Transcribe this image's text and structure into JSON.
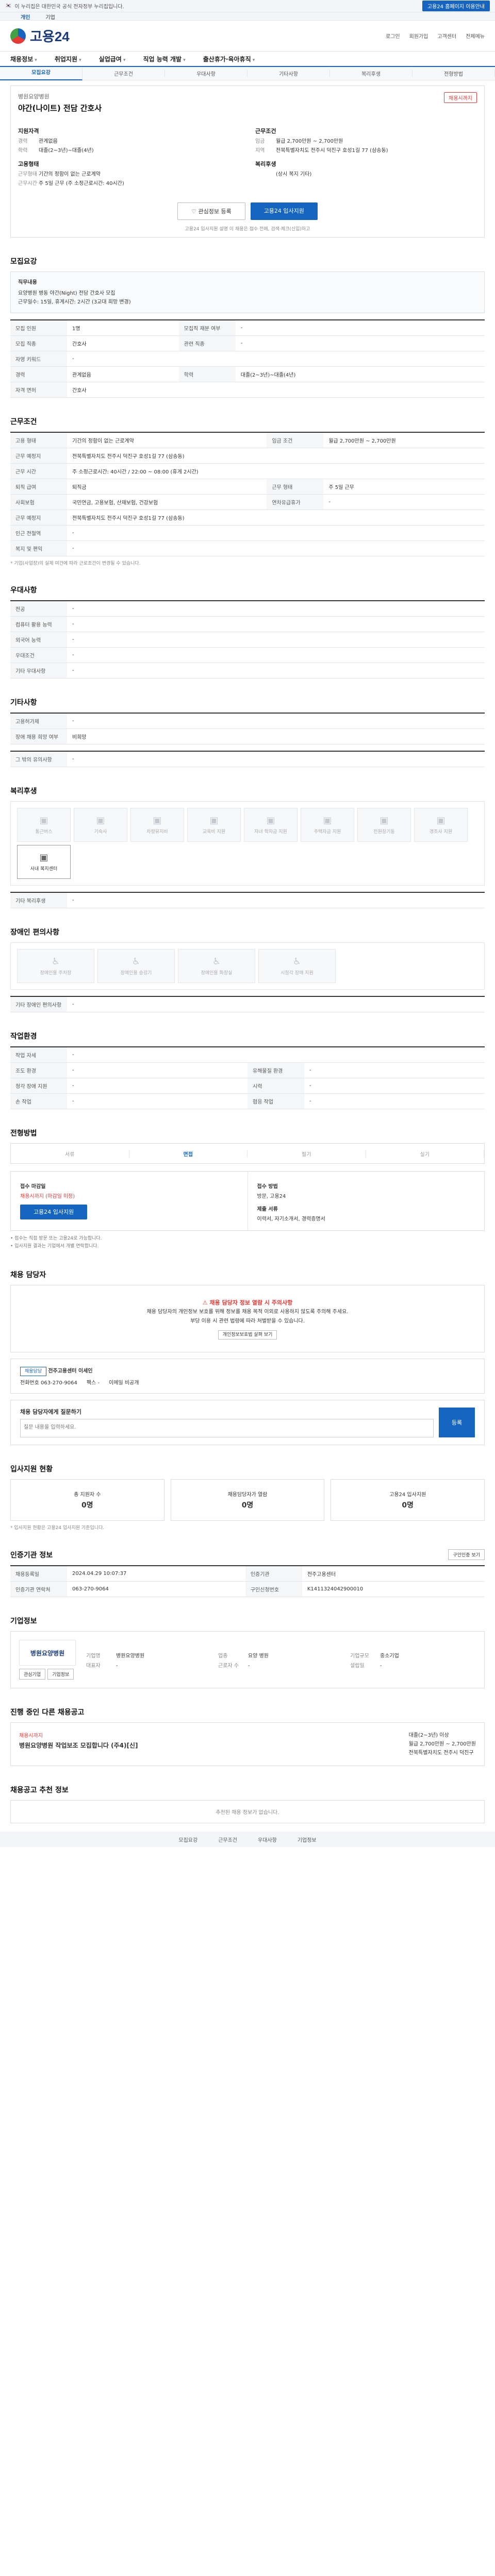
{
  "topbar": {
    "notice": "이 누리집은 대한민국 공식 전자정부 누리집입니다.",
    "tab_person": "개인",
    "tab_company": "기업",
    "right_btn": "고용24 홈페이지 이용안내"
  },
  "logo": {
    "name": "고용24"
  },
  "header_links": [
    "로그인",
    "회원가입",
    "고객센터",
    "전체메뉴"
  ],
  "nav": [
    "채용정보",
    "취업지원",
    "실업급여",
    "직업 능력 개발",
    "출산휴가·육아휴직"
  ],
  "subnav": [
    "모집요강",
    "근무조건",
    "우대사항",
    "기타사항",
    "복리후생",
    "전형방법"
  ],
  "summary": {
    "company": "병원요양병원",
    "title": "야간(나이트) 전담 간호사",
    "badge": "채용시까지",
    "left_title": "지원자격",
    "right_title": "근무조건",
    "left": [
      {
        "k": "경력",
        "v": "관계없음"
      },
      {
        "k": "학력",
        "v": "대졸(2~3년)~대졸(4년)"
      }
    ],
    "right": [
      {
        "k": "임금",
        "v": "월급 2,700만원 ~ 2,700만원"
      },
      {
        "k": "지역",
        "v": "전북특별자치도 전주시 덕진구 호성1길 77 (삼송동)"
      }
    ],
    "left2_title": "고용형태",
    "left2": [
      {
        "k": "근무형태",
        "v": "기간의 정함이 없는 근로계약"
      },
      {
        "k": "근무시간",
        "v": "주 5일 근무 (주 소정근로시간: 40시간)"
      }
    ],
    "right2_title": "복리후생",
    "right2": [
      {
        "k": "",
        "v": "(상시 복지 기타)"
      }
    ],
    "save_btn": "관심정보 등록",
    "apply_btn": "고용24 입사지원",
    "note": "고용24 입사지원 설명 이 채용은 접수 전에, 검색·체크(신입)하고 "
  },
  "recruit": {
    "section": "모집요강",
    "box_h": "직무내용",
    "box_lines": [
      "요양병원 병동 야간(Night) 전담 간호사 모집",
      "근무일수: 15일, 휴게시간: 2시간 (3교대 희망 변경)"
    ],
    "rows": [
      [
        "모집 인원",
        "1명",
        "모집직 재분 여부",
        "-"
      ],
      [
        "모집 직종",
        "간호사",
        "관련 직종",
        "-"
      ],
      [
        "자영 키워드",
        "-",
        "",
        ""
      ],
      [
        "경력",
        "관계없음",
        "학력",
        "대졸(2~3년)~대졸(4년)"
      ],
      [
        "자격 면허",
        "간호사",
        "",
        ""
      ]
    ]
  },
  "condition": {
    "section": "근무조건",
    "rows": [
      [
        "고용 형태",
        "기간의 정함이 없는 근로계약",
        "임금 조건",
        "월급 2,700만원 ~ 2,700만원"
      ],
      [
        "근무 예정지",
        "전북특별자치도 전주시 덕진구 호성1길 77 (삼송동)",
        "",
        ""
      ],
      [
        "근무 시간",
        "주 소정근로시간: 40시간 / 22:00 ~ 08:00 (휴게 2시간)",
        "",
        ""
      ],
      [
        "퇴직 급여",
        "퇴직금",
        "근무 형태",
        "주 5일 근무"
      ],
      [
        "사회보험",
        "국민연금, 고용보험, 산재보험, 건강보험",
        "연차유급휴가",
        "-"
      ],
      [
        "근무 예정지",
        "전북특별자치도 전주시 덕진구 호성1길 77 (삼송동)",
        "",
        ""
      ],
      [
        "인근 전철역",
        "-",
        "",
        ""
      ],
      [
        "복지 및 편익",
        "-",
        "",
        ""
      ]
    ],
    "note": "* 기업(사업장)의 실제 여건에 따라 근로조건이 변경될 수 있습니다."
  },
  "prefer": {
    "section": "우대사항",
    "rows": [
      [
        "전공",
        "-"
      ],
      [
        "컴퓨터 활용 능력",
        "-"
      ],
      [
        "외국어 능력",
        "-"
      ],
      [
        "우대조건",
        "-"
      ],
      [
        "기타 우대사항",
        "-"
      ]
    ]
  },
  "etc": {
    "section": "기타사항",
    "rows": [
      [
        "고용허가제",
        "-"
      ],
      [
        "장애 채용 희망 여부",
        "비희망"
      ]
    ],
    "sub_h": "그 밖의 유의사항",
    "sub_v": "-"
  },
  "welfare": {
    "section": "복리후생",
    "items": [
      "통근버스",
      "기숙사",
      "차량유지비",
      "교육비 지원",
      "자녀 학자금 지원",
      "주택자금 지원",
      "전원장기동",
      "경조사 지원",
      "사내 복지센터"
    ],
    "active_index": 8,
    "extra_h": "기타 복리후생",
    "extra_v": "-"
  },
  "disability": {
    "section": "장애인 편의사항",
    "items": [
      "장애인용 주차장",
      "장애인용 승강기",
      "장애인용 화장실",
      "시청각 장애 지원"
    ],
    "extra_h": "기타 장애인 편의사항",
    "extra_v": "-"
  },
  "workenv": {
    "section": "작업환경",
    "rows": [
      [
        "작업 자세",
        "-",
        "",
        ""
      ],
      [
        "조도 환경",
        "-",
        "유해물질 환경",
        "-"
      ],
      [
        "청각 장애 지원",
        "-",
        "시력",
        "-"
      ],
      [
        "손 작업",
        "-",
        "협응 작업",
        "-"
      ]
    ]
  },
  "selection": {
    "section": "전형방법",
    "steps": [
      "서류",
      "면접",
      "필기",
      "실기"
    ],
    "active": 1,
    "apply_left_h": "접수 마감일",
    "apply_left_v": "채용시까지 (마감일 미정)",
    "apply_left_btn": "고용24 입사지원",
    "apply_right_h": "접수 방법",
    "apply_right_v": "방문, 고용24",
    "apply_right_h2": "제출 서류",
    "apply_right_v2": "이력서, 자기소개서, 경력증명서",
    "notes": [
      "• 접수는 직접 방문 또는 고용24로 가능합니다.",
      "• 입사지원 결과는 기업에서 개별 연락합니다."
    ]
  },
  "manager": {
    "section": "채용 담당자",
    "warn_title": "채용 담당자 정보 열람 시 주의사항",
    "warn_lines": [
      "채용 담당자의 개인정보 보호를 위해 정보를 채용 목적 이외로 사용하지 않도록 주의해 주세요.",
      "부당 이용 시 관련 법령에 따라 처벌받을 수 있습니다."
    ],
    "warn_btn": "개인정보보호법 살펴 보기",
    "tag": "채용담당",
    "name": "전주고용센터 이세인",
    "phone_label": "전화번호",
    "phone": "063-270-9064",
    "fax_label": "팩스",
    "fax": "-",
    "email_label": "이메일",
    "email": "비공개",
    "q_title": "채용 담당자에게 질문하기",
    "q_placeholder": "질문 내용을 입력하세요.",
    "q_btn": "등록"
  },
  "stats": {
    "section": "입사지원 현황",
    "cards": [
      {
        "h": "총 지원자 수",
        "v": "0명"
      },
      {
        "h": "채용담당자가 열람",
        "v": "0명"
      },
      {
        "h": "고용24 입사지원",
        "v": "0명"
      }
    ],
    "note": "* 입사지원 현황은 고용24 입사지원 기준입니다."
  },
  "agency": {
    "section": "인증기관 정보",
    "btn": "구인인증 보기",
    "rows": [
      [
        "채용등록일",
        "2024.04.29 10:07:37",
        "인증기관",
        "전주고용센터"
      ],
      [
        "인증기관 연락처",
        "063-270-9064",
        "구인신청번호",
        "K1411324042900010"
      ]
    ]
  },
  "company": {
    "section": "기업정보",
    "logo": "병원요양병원",
    "btn1": "관심기업",
    "btn2": "기업정보",
    "fields": [
      {
        "k": "기업명",
        "v": "병원요양병원"
      },
      {
        "k": "업종",
        "v": "요양 병원"
      },
      {
        "k": "기업규모",
        "v": "중소기업"
      },
      {
        "k": "대표자",
        "v": "-"
      },
      {
        "k": "근로자 수",
        "v": "-"
      },
      {
        "k": "설립일",
        "v": "-"
      }
    ]
  },
  "other": {
    "section": "진행 중인 다른 채용공고",
    "title": "병원요양병원 작업보조 모집합니다 (주4)[신]",
    "sub": "채용시까지",
    "lines": [
      "대졸(2~3년) 이상",
      "월급 2,700만원 ~ 2,700만원",
      "전북특별자치도 전주시 덕진구"
    ]
  },
  "reco": {
    "section": "채용공고 추천 정보",
    "empty": "추천된 채용 정보가 없습니다."
  },
  "bottom": [
    "모집요강",
    "근무조건",
    "우대사항",
    "기업정보"
  ]
}
